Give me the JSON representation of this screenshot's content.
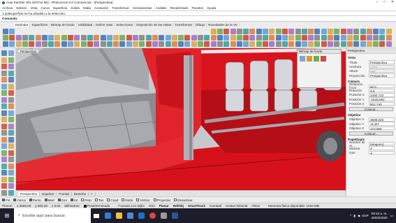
{
  "window": {
    "title": "Auto Karritier 001 (007/14 kB) - Rhinoceros 5.0 Commercial - [Perspectiva]"
  },
  "menu": [
    "Archivo",
    "Edición",
    "Vista",
    "Curva",
    "Superficie",
    "Sólido",
    "Malla",
    "Acotación",
    "Transformar",
    "Herramientas",
    "Análisis",
    "Renderizado",
    "Paneles",
    "Ayuda"
  ],
  "command_history": "1 polisuperficie se ha añadido a la selección.",
  "command_prompt": "Comando:",
  "toolbar_tabs": [
    {
      "label": "Estándar",
      "active": true
    },
    {
      "label": "Superficies"
    },
    {
      "label": "Bitmap de fondo"
    },
    {
      "label": "Visibilidad"
    },
    {
      "label": "Definir vista"
    },
    {
      "label": "Seleccionar"
    },
    {
      "label": "Disposición de las vistas"
    },
    {
      "label": "Transformar"
    },
    {
      "label": "Dibujo"
    },
    {
      "label": "Novedades de la V5"
    }
  ],
  "viewport": {
    "title": "Perspectiva",
    "tabs": [
      {
        "label": "Perspectiva",
        "active": true
      },
      {
        "label": "Superior"
      },
      {
        "label": "Frontal"
      },
      {
        "label": "Derecha"
      },
      {
        "label": "+"
      }
    ]
  },
  "popup": {
    "title": "Bitmap de fondo"
  },
  "osnaps": [
    {
      "label": "Fin",
      "on": true
    },
    {
      "label": "Cerca",
      "on": true
    },
    {
      "label": "Punto",
      "on": true
    },
    {
      "label": "Med",
      "on": true
    },
    {
      "label": "Cen",
      "on": true
    },
    {
      "label": "Int",
      "on": true
    },
    {
      "label": "Perp",
      "on": false
    },
    {
      "label": "Tan",
      "on": false
    },
    {
      "label": "Cuad",
      "on": false
    },
    {
      "label": "Nodo",
      "on": false
    },
    {
      "label": "Vértice",
      "on": false
    },
    {
      "label": "Proyectar",
      "on": false
    },
    {
      "label": "Desactivar",
      "on": false
    }
  ],
  "status": {
    "plane": "PlanoC",
    "x": "x 3509.00",
    "y": "y 606.46",
    "z": "z 0.00",
    "units": "Milímetros",
    "layer": "Predeterminada",
    "items": [
      "Forzado a la rejilla",
      "Orto",
      "Planar",
      "RefObj",
      "SmartTrack",
      "Gumball",
      "Grabar historial",
      "Filtrar"
    ],
    "memory": "Memoria física disponible: 1534 MB"
  },
  "panel": {
    "tab_label": "Perspectiva",
    "sections": [
      {
        "title": "Vista",
        "rows": [
          {
            "k": "Título",
            "v": "Perspectiva"
          },
          {
            "k": "Anchura",
            "v": "1270",
            "dis": true
          },
          {
            "k": "Altura",
            "v": "565",
            "dis": true
          },
          {
            "k": "Proyección",
            "v": "Perspectiva"
          }
        ]
      },
      {
        "title": "Cámara",
        "rows": [
          {
            "k": "Distancia focal",
            "v": "50.0"
          },
          {
            "k": "Rotación",
            "v": "0.0"
          },
          {
            "k": "Posición X",
            "v": "2400.710"
          },
          {
            "k": "Posición Y",
            "v": "-1545.862"
          },
          {
            "k": "Posición Z",
            "v": "601.740"
          }
        ],
        "button": "Colocar..."
      },
      {
        "title": "Objetivo",
        "rows": [
          {
            "k": "Objetivo X",
            "v": "3608.025"
          },
          {
            "k": "Objetivo Y",
            "v": "-8.327"
          },
          {
            "k": "Objetivo Z",
            "v": "172.500"
          }
        ],
        "button": "Colocar..."
      },
      {
        "title": "Papelitapiz",
        "rows": [
          {
            "k": "Nombre de ar...",
            "v": "(ninguno)"
          },
          {
            "k": "Mostrar",
            "v": "✔"
          },
          {
            "k": "Gris",
            "v": "✔"
          }
        ]
      }
    ]
  },
  "taskbar": {
    "search_placeholder": "Escribe aquí para buscar",
    "lang": "ESP",
    "time": "09:10 a. m.",
    "date": "28/02/2020"
  },
  "colors": {
    "car_red": "#d7111b",
    "metal": "#b4b4b8",
    "accent": "#3a6fb0"
  }
}
